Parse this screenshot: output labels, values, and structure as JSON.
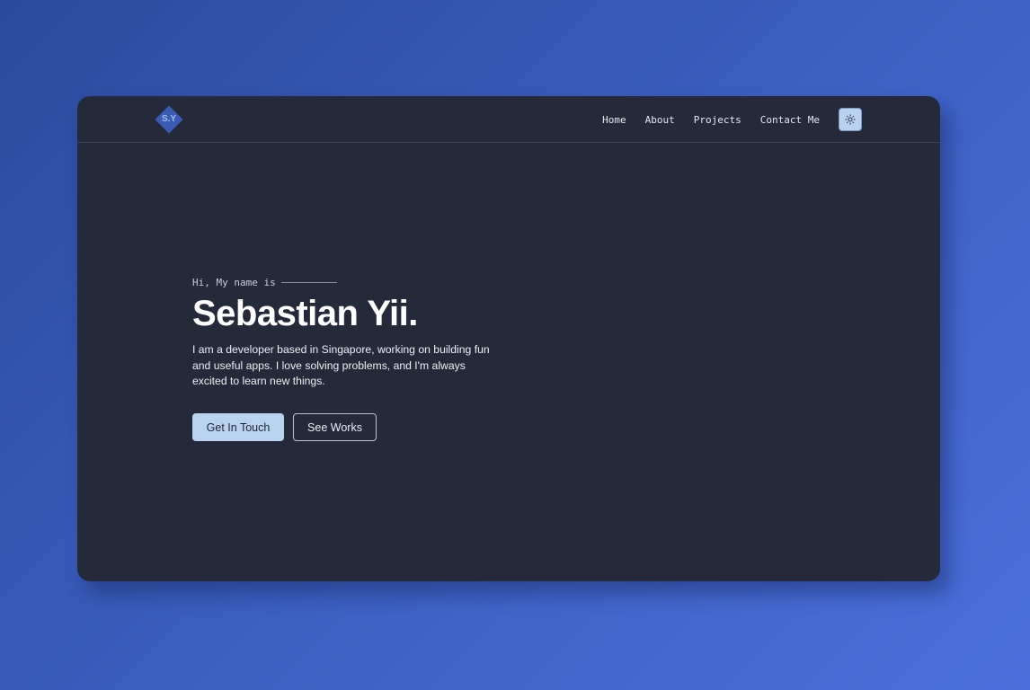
{
  "logo": {
    "text": "S.Y",
    "color": "#3a5cb5"
  },
  "nav": {
    "links": [
      {
        "label": "Home"
      },
      {
        "label": "About"
      },
      {
        "label": "Projects"
      },
      {
        "label": "Contact Me"
      }
    ],
    "theme_toggle_icon": "sun-icon"
  },
  "hero": {
    "greeting": "Hi, My name is",
    "name": "Sebastian Yii.",
    "bio": "I am a developer based in Singapore, working on building fun and useful apps. I love solving problems, and I'm always excited to learn new things.",
    "primary_button": "Get In Touch",
    "secondary_button": "See Works"
  },
  "colors": {
    "background_gradient_start": "#2c4a9c",
    "background_gradient_end": "#4a6fdc",
    "window": "#252a3a",
    "accent": "#b9d3ef"
  }
}
